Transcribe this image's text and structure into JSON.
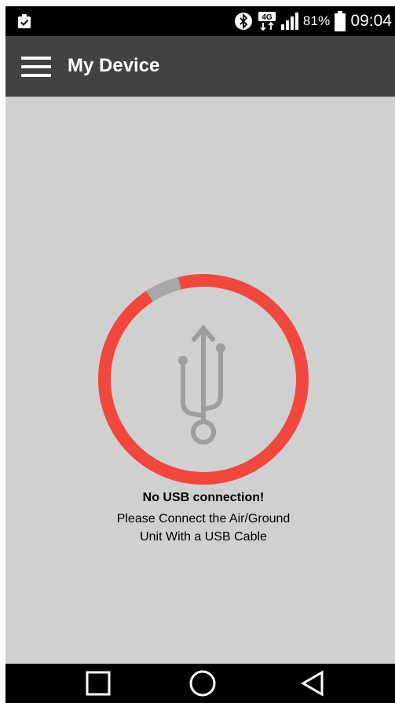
{
  "status_bar": {
    "network_label": "4G",
    "battery_percent": "81%",
    "time": "09:04",
    "icons": [
      "clipboard-check-icon",
      "bluetooth-icon",
      "network-4g-icon",
      "signal-icon",
      "battery-icon"
    ]
  },
  "app_bar": {
    "title": "My Device",
    "menu_icon": "hamburger-menu-icon"
  },
  "main": {
    "status_icon": "usb-icon",
    "progress_ring": {
      "accent_color": "#f0473f",
      "track_color": "#a8a8a8"
    },
    "message_title": "No USB connection!",
    "message_line1": "Please Connect the Air/Ground",
    "message_line2": "Unit With a USB Cable"
  },
  "nav_bar": {
    "buttons": [
      "recents-button",
      "home-button",
      "back-button"
    ]
  }
}
